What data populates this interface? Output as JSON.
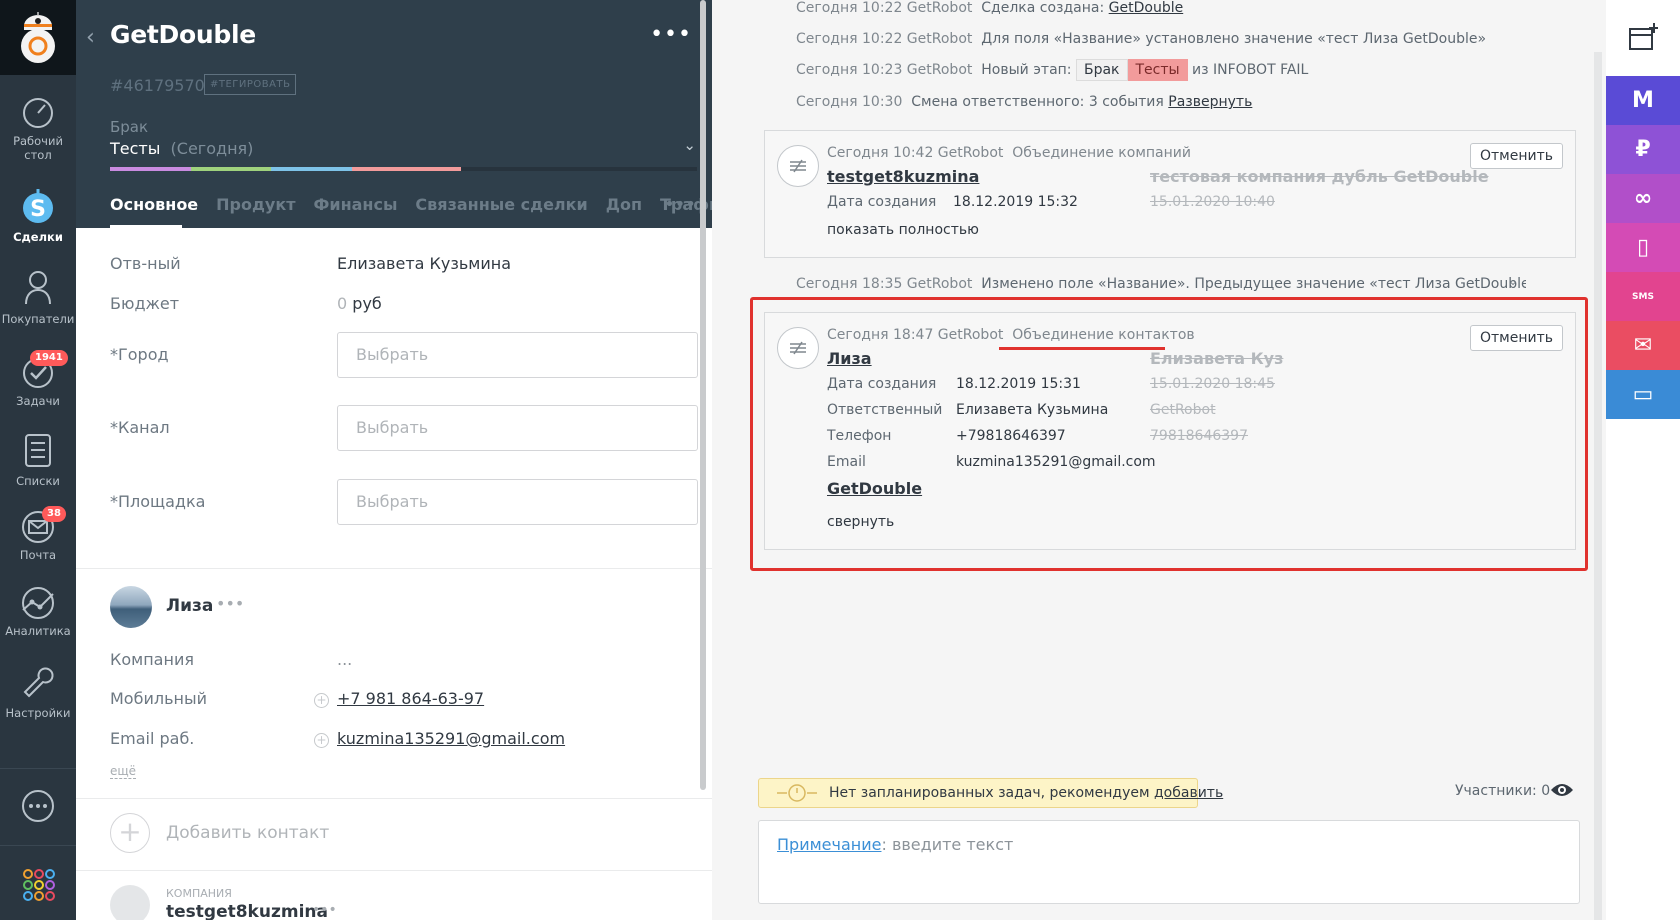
{
  "nav": {
    "items": [
      {
        "label": "Рабочий стол"
      },
      {
        "label": "Сделки"
      },
      {
        "label": "Покупатели"
      },
      {
        "label": "Задачи",
        "badge": "1941"
      },
      {
        "label": "Списки"
      },
      {
        "label": "Почта",
        "badge": "38"
      },
      {
        "label": "Аналитика"
      },
      {
        "label": "Настройки"
      }
    ]
  },
  "deal": {
    "title": "GetDouble",
    "id": "#46179570",
    "tag_button": "#ТЕГИРОВАТЬ",
    "pipeline": "Брак",
    "stage": "Тесты",
    "stage_date": "(Сегодня)",
    "tabs": [
      "Основное",
      "Продукт",
      "Финансы",
      "Связанные сделки",
      "Доп",
      "Трафик"
    ],
    "progress_colors": [
      "#c98be0",
      "#9fd27d",
      "#7ec3e8",
      "#f29b9b"
    ],
    "progress_fraction": 0.55
  },
  "fields": {
    "responsible_label": "Отв-ный",
    "responsible_value": "Елизавета Кузьмина",
    "budget_label": "Бюджет",
    "budget_value": "0",
    "budget_currency": "руб",
    "city_label": "*Город",
    "channel_label": "*Канал",
    "platform_label": "*Площадка",
    "select_placeholder": "Выбрать"
  },
  "contact": {
    "name": "Лиза",
    "company_label": "Компания",
    "company_value": "...",
    "mobile_label": "Мобильный",
    "mobile_value": "+7 981 864-63-97",
    "email_label": "Email раб.",
    "email_value": "kuzmina135291@gmail.com",
    "more": "ещё",
    "add_contact": "Добавить контакт"
  },
  "company": {
    "section_label": "КОМПАНИЯ",
    "name": "testget8kuzmina"
  },
  "feed": {
    "events": [
      {
        "time": "Сегодня 10:22 GetRobot",
        "text": "Сделка создана:",
        "link": "GetDouble"
      },
      {
        "time": "Сегодня 10:22 GetRobot",
        "text": "Для поля «Название» установлено значение «тест Лиза GetDouble»"
      },
      {
        "time": "Сегодня 10:23 GetRobot",
        "text": "Новый этап:",
        "chip1": "Брак",
        "chip2": "Тесты",
        "tail": "из INFOBOT FAIL"
      },
      {
        "time": "Сегодня 10:30",
        "text": "Смена ответственного: 3 события",
        "link": "Развернуть"
      }
    ],
    "merge_companies": {
      "time": "Сегодня 10:42 GetRobot",
      "title": "Объединение компаний",
      "cancel": "Отменить",
      "name": "testget8kuzmina",
      "old_name": "тестовая компания дубль GetDouble",
      "created_label": "Дата создания",
      "created_value": "18.12.2019 15:32",
      "old_created": "15.01.2020 10:40",
      "show_full": "показать полностью"
    },
    "rename_event": {
      "time": "Сегодня 18:35 GetRobot",
      "text": "Изменено поле «Название». Предыдущее значение «тест Лиза GetDouble», новое з"
    },
    "merge_contacts": {
      "time": "Сегодня 18:47 GetRobot",
      "title": "Объединение контактов",
      "cancel": "Отменить",
      "name": "Лиза",
      "old_name": "Елизавета Куз",
      "created_label": "Дата создания",
      "created_value": "18.12.2019 15:31",
      "old_created": "15.01.2020 18:45",
      "responsible_label": "Ответственный",
      "responsible_value": "Елизавета Кузьмина",
      "old_responsible": "GetRobot",
      "phone_label": "Телефон",
      "phone_value": "+79818646397",
      "old_phone": "79818646397",
      "email_label": "Email",
      "email_value": "kuzmina135291@gmail.com",
      "company_link": "GetDouble",
      "collapse": "свернуть"
    },
    "task_notice": "Нет запланированных задач, рекомендуем",
    "task_link": "добавить",
    "participants": "Участники: 0",
    "note_label": "Примечание",
    "note_placeholder": ": введите текст"
  },
  "colors": {
    "nav_bg": "#2a3640",
    "header_bg": "#2f3f4b",
    "highlight": "#e0322e",
    "right_bar": [
      "#5a4bd6",
      "#8e52d6",
      "#b14fc9",
      "#d44bb5",
      "#e2448f",
      "#ea4d62",
      "#3a8bd6"
    ]
  }
}
